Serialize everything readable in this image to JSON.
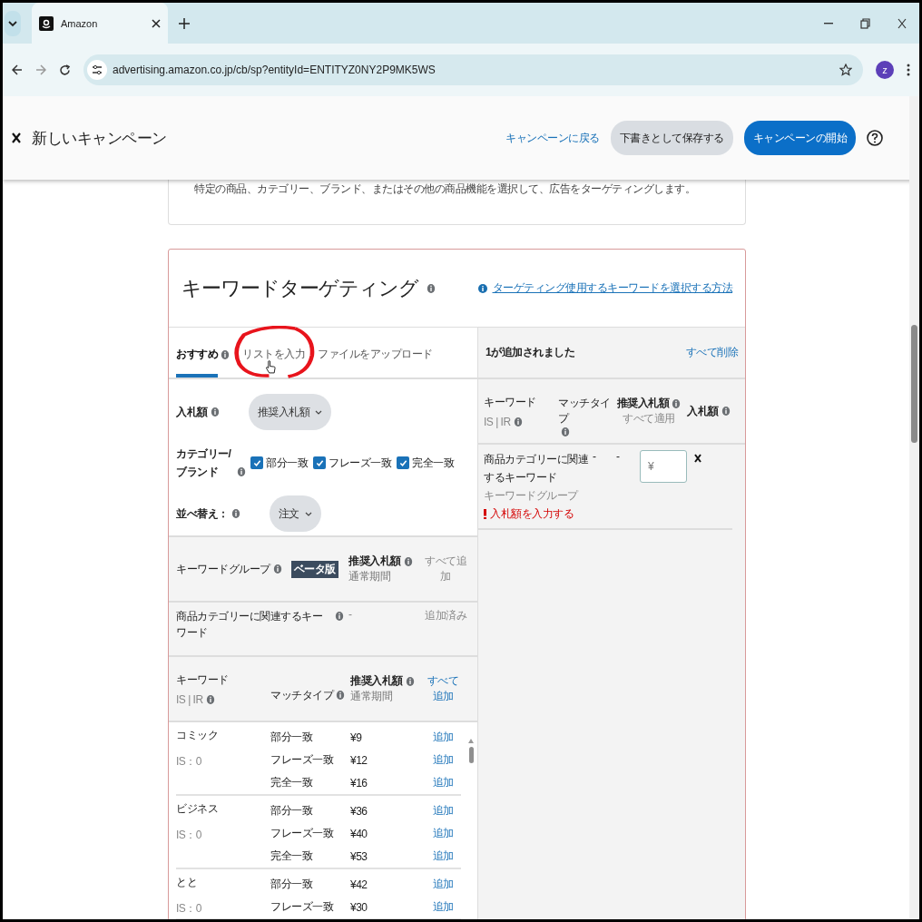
{
  "browser": {
    "tab_title": "Amazon",
    "url": "advertising.amazon.co.jp/cb/sp?entityId=ENTITYZ0NY2P9MK5WS",
    "profile_initial": "ｚ"
  },
  "header": {
    "title": "新しいキャンペーン",
    "back_link": "キャンペーンに戻る",
    "save_button": "下書きとして保存する",
    "start_button": "キャンペーンの開始"
  },
  "intro_text": "特定の商品、カテゴリー、ブランド、またはその他の商品機能を選択して、広告をターゲティングします。",
  "keyword_card": {
    "title": "キーワードターゲティング",
    "help_link": "ターゲティング使用するキーワードを選択する方法",
    "tabs": [
      {
        "label": "おすすめ",
        "selected": true,
        "info": true
      },
      {
        "label": "リストを入力",
        "selected": false,
        "info": false
      },
      {
        "label": "ファイルをアップロード",
        "selected": false,
        "info": false
      }
    ],
    "bid_label": "入札額",
    "bid_dropdown": "推奨入札額",
    "category_label": "カテゴリー/ブランド",
    "match_checkboxes": [
      {
        "label": "部分一致",
        "checked": true
      },
      {
        "label": "フレーズ一致",
        "checked": true
      },
      {
        "label": "完全一致",
        "checked": true
      }
    ],
    "sort_label": "並べ替え：",
    "sort_dropdown": "注文",
    "group_table": {
      "group_header": "キーワードグループ",
      "beta_badge": "ベータ版",
      "bid_header": "推奨入札額",
      "bid_sub": "通常期間",
      "add_all": "すべて追加",
      "rows": [
        {
          "name": "商品カテゴリーに関連するキーワード",
          "bid": "-",
          "status": "追加済み"
        }
      ]
    },
    "keyword_table": {
      "keyword_header": "キーワード",
      "isir_header": "IS | IR",
      "match_header": "マッチタイプ",
      "bid_header": "推奨入札額",
      "bid_sub": "通常期間",
      "add_all": "すべて追加",
      "keywords": [
        {
          "name": "コミック",
          "is": "IS：0",
          "matches": [
            {
              "type": "部分一致",
              "bid": "¥9",
              "action": "追加"
            },
            {
              "type": "フレーズ一致",
              "bid": "¥12",
              "action": "追加"
            },
            {
              "type": "完全一致",
              "bid": "¥16",
              "action": "追加"
            }
          ]
        },
        {
          "name": "ビジネス",
          "is": "IS：0",
          "matches": [
            {
              "type": "部分一致",
              "bid": "¥36",
              "action": "追加"
            },
            {
              "type": "フレーズ一致",
              "bid": "¥40",
              "action": "追加"
            },
            {
              "type": "完全一致",
              "bid": "¥53",
              "action": "追加"
            }
          ]
        },
        {
          "name": "とと",
          "is": "IS：0",
          "matches": [
            {
              "type": "部分一致",
              "bid": "¥42",
              "action": "追加"
            },
            {
              "type": "フレーズ一致",
              "bid": "¥30",
              "action": "追加"
            }
          ]
        }
      ]
    },
    "added_panel": {
      "count_text": "1が追加されました",
      "remove_all": "すべて削除",
      "keyword_header": "キーワード",
      "isir_header": "IS | IR",
      "match_header": "マッチタイプ",
      "bid_header": "推奨入札額",
      "apply_all": "すべて適用",
      "your_bid_header": "入札額",
      "rows": [
        {
          "name": "商品カテゴリーに関連するキーワード",
          "group": "キーワードグループ",
          "match": "-",
          "bid": "-",
          "placeholder": "¥",
          "error": "入札額を入力する"
        }
      ]
    }
  }
}
